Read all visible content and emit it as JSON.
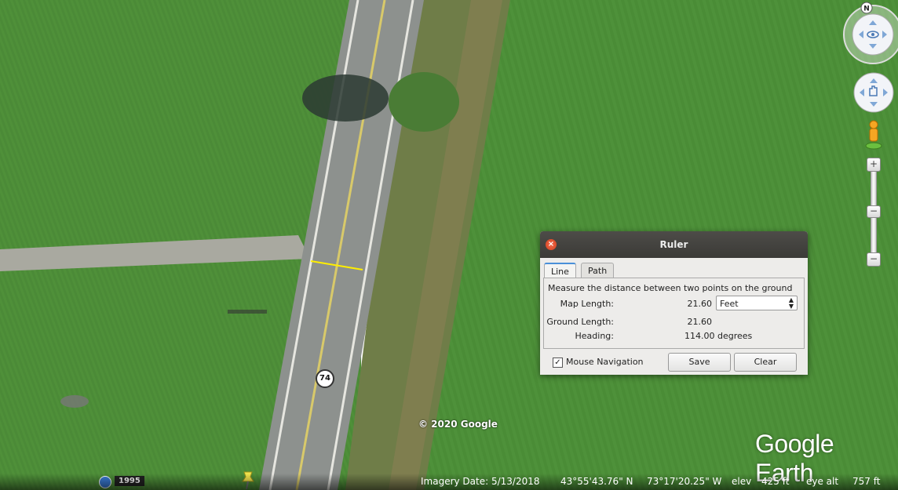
{
  "map": {
    "copyright": "© 2020 Google",
    "logo": "Google Earth",
    "route_shield": "74",
    "historical_year": "1995",
    "compass_north": "N"
  },
  "ruler": {
    "title": "Ruler",
    "tabs": [
      {
        "label": "Line",
        "active": true
      },
      {
        "label": "Path",
        "active": false
      }
    ],
    "description": "Measure the distance between two points on the ground",
    "map_length_label": "Map Length:",
    "map_length_value": "21.60",
    "unit_selected": "Feet",
    "ground_length_label": "Ground Length:",
    "ground_length_value": "21.60",
    "heading_label": "Heading:",
    "heading_value": "114.00 degrees",
    "mouse_navigation_label": "Mouse Navigation",
    "mouse_navigation_checked": true,
    "save_label": "Save",
    "clear_label": "Clear"
  },
  "status": {
    "imagery_date": "Imagery Date: 5/13/2018",
    "lat": "43°55'43.76\" N",
    "lon": "73°17'20.25\" W",
    "elev_label": "elev",
    "elev_value": "425 ft",
    "eye_alt_label": "eye alt",
    "eye_alt_value": "757 ft"
  },
  "colors": {
    "measure_line": "#ffee00",
    "field": "#4f8a3a",
    "road": "#8c8f8d"
  }
}
